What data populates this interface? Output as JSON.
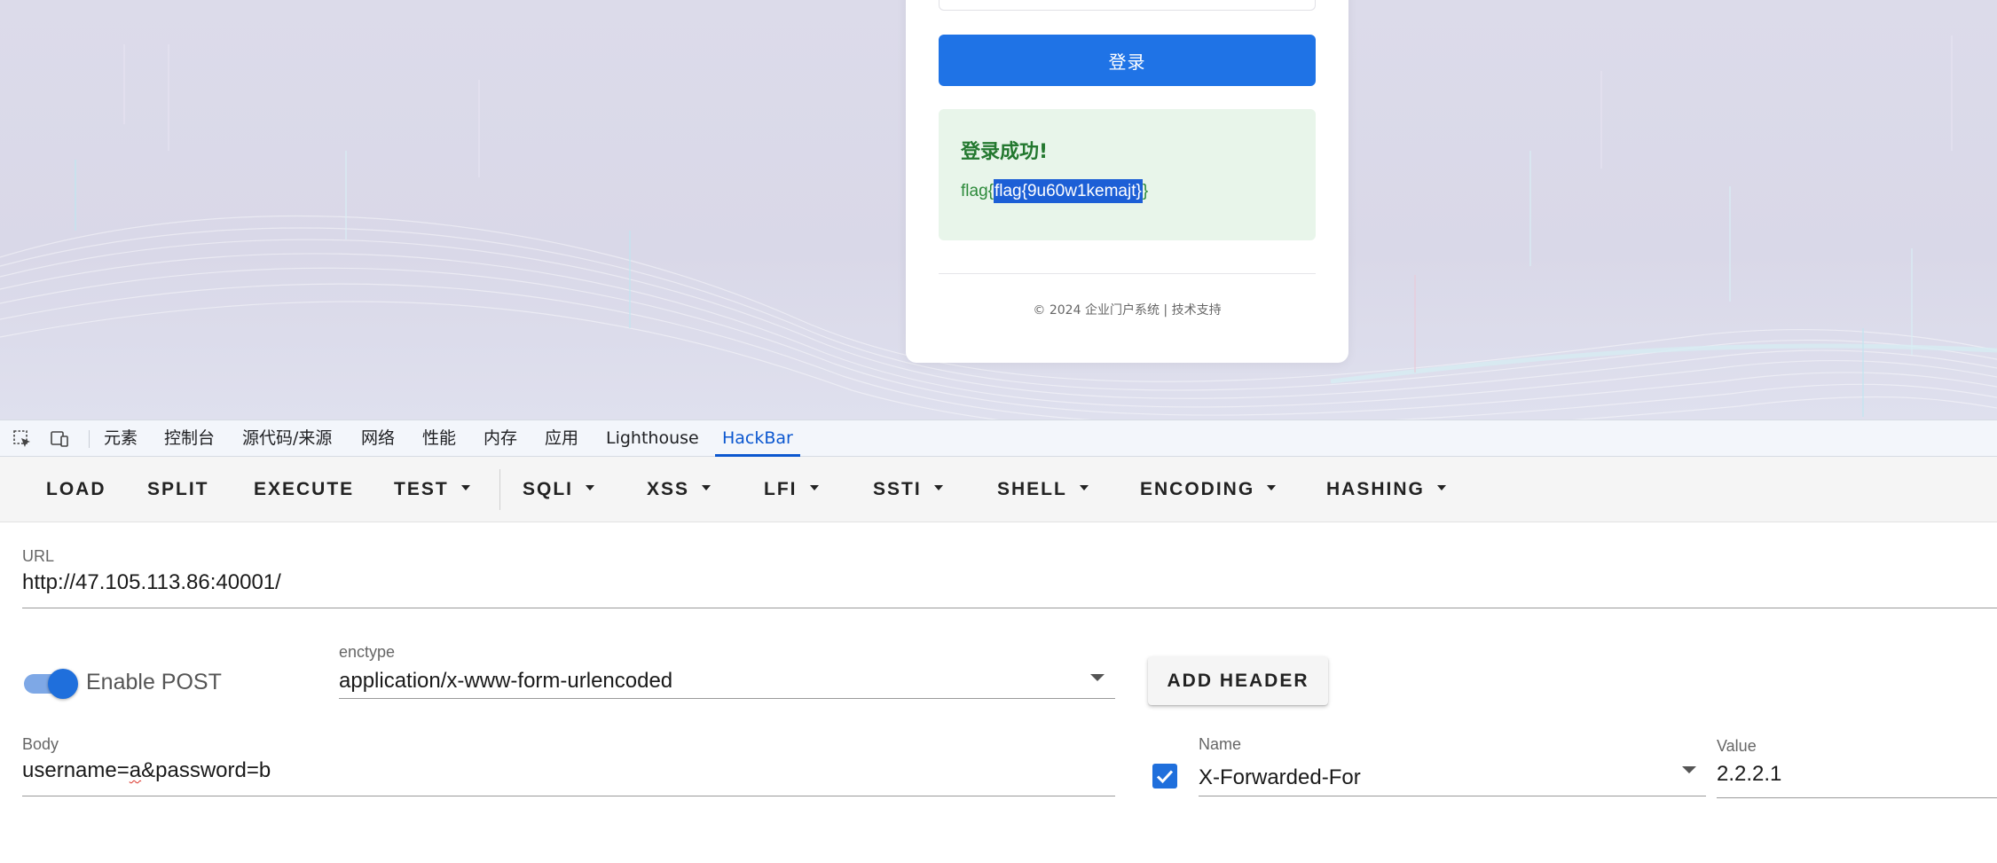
{
  "webpage": {
    "login_button": "登录",
    "success_title": "登录成功!",
    "flag_prefix": "flag{",
    "flag_selected": "flag{9u60w1kemajt}",
    "flag_suffix": "}",
    "footer": "© 2024 企业门户系统 | 技术支持"
  },
  "devtools": {
    "icons": [
      "inspect-element-icon",
      "device-toolbar-icon"
    ],
    "tabs": [
      "元素",
      "控制台",
      "源代码/来源",
      "网络",
      "性能",
      "内存",
      "应用",
      "Lighthouse",
      "HackBar"
    ],
    "active_tab": "HackBar"
  },
  "hackbar": {
    "toolbar": [
      {
        "label": "LOAD",
        "dropdown": false
      },
      {
        "label": "SPLIT",
        "dropdown": false
      },
      {
        "label": "EXECUTE",
        "dropdown": false
      },
      {
        "label": "TEST",
        "dropdown": true
      },
      {
        "label": "SQLI",
        "dropdown": true
      },
      {
        "label": "XSS",
        "dropdown": true
      },
      {
        "label": "LFI",
        "dropdown": true
      },
      {
        "label": "SSTI",
        "dropdown": true
      },
      {
        "label": "SHELL",
        "dropdown": true
      },
      {
        "label": "ENCODING",
        "dropdown": true
      },
      {
        "label": "HASHING",
        "dropdown": true
      }
    ],
    "url": {
      "label": "URL",
      "value": "http://47.105.113.86:40001/"
    },
    "enable_post": {
      "label": "Enable POST",
      "checked": true
    },
    "enctype": {
      "label": "enctype",
      "value": "application/x-www-form-urlencoded"
    },
    "add_header_label": "ADD HEADER",
    "body": {
      "label": "Body",
      "value_part1": "username=",
      "value_squiggle": "a",
      "value_part2": "&password=b"
    },
    "header": {
      "enabled": true,
      "name_label": "Name",
      "name_value": "X-Forwarded-For",
      "value_label": "Value",
      "value_value": "2.2.2.1"
    }
  },
  "colors": {
    "primary_blue": "#1f73e6",
    "success_green": "#23782f",
    "active_tab_blue": "#0b57d0"
  }
}
